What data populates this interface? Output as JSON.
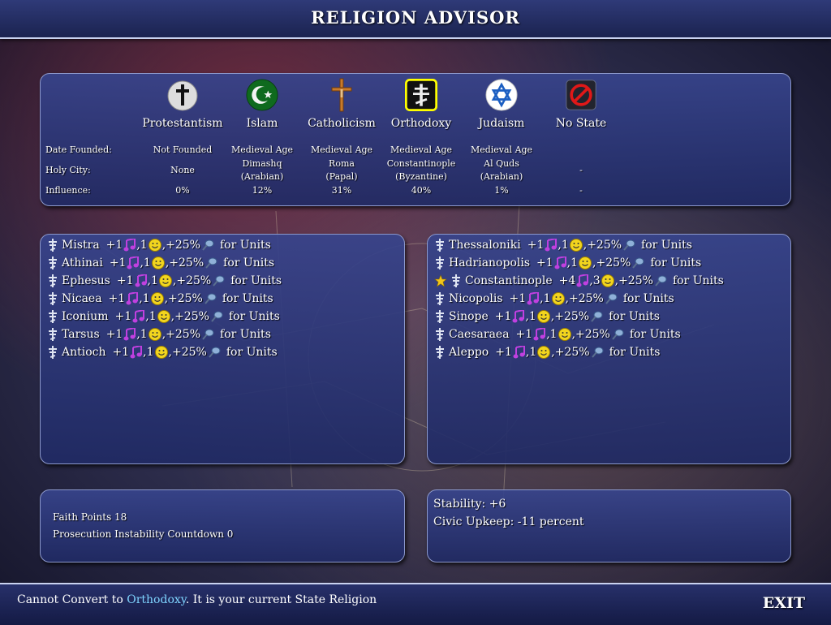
{
  "window": {
    "title": "RELIGION ADVISOR"
  },
  "religions": [
    {
      "name": "Protestantism",
      "icon": "protestantism-icon",
      "date_founded": "Not Founded",
      "holy_city": [
        "None"
      ],
      "influence": "0%",
      "selected": false
    },
    {
      "name": "Islam",
      "icon": "islam-icon",
      "date_founded": "Medieval Age",
      "holy_city": [
        "Dimashq",
        "(Arabian)"
      ],
      "influence": "12%",
      "selected": false
    },
    {
      "name": "Catholicism",
      "icon": "catholicism-icon",
      "date_founded": "Medieval Age",
      "holy_city": [
        "Roma",
        "(Papal)"
      ],
      "influence": "31%",
      "selected": false
    },
    {
      "name": "Orthodoxy",
      "icon": "orthodoxy-icon",
      "date_founded": "Medieval Age",
      "holy_city": [
        "Constantinople",
        "(Byzantine)"
      ],
      "influence": "40%",
      "selected": true
    },
    {
      "name": "Judaism",
      "icon": "judaism-icon",
      "date_founded": "Medieval Age",
      "holy_city": [
        "Al Quds",
        "(Arabian)"
      ],
      "influence": "1%",
      "selected": false
    },
    {
      "name": "No State",
      "icon": "no-state-icon",
      "date_founded": "",
      "holy_city": [
        "-"
      ],
      "influence": "-",
      "selected": false
    }
  ],
  "row_labels": {
    "date_founded": "Date Founded:",
    "holy_city": "Holy City:",
    "influence": "Influence:"
  },
  "city_lists": {
    "left": [
      {
        "name": "Mistra",
        "culture": "+1",
        "happy": "1",
        "bonus": "+25%",
        "suffix": "for Units",
        "capital": false
      },
      {
        "name": "Athinai",
        "culture": "+1",
        "happy": "1",
        "bonus": "+25%",
        "suffix": "for Units",
        "capital": false
      },
      {
        "name": "Ephesus",
        "culture": "+1",
        "happy": "1",
        "bonus": "+25%",
        "suffix": "for Units",
        "capital": false
      },
      {
        "name": "Nicaea",
        "culture": "+1",
        "happy": "1",
        "bonus": "+25%",
        "suffix": "for Units",
        "capital": false
      },
      {
        "name": "Iconium",
        "culture": "+1",
        "happy": "1",
        "bonus": "+25%",
        "suffix": "for Units",
        "capital": false
      },
      {
        "name": "Tarsus",
        "culture": "+1",
        "happy": "1",
        "bonus": "+25%",
        "suffix": "for Units",
        "capital": false
      },
      {
        "name": "Antioch",
        "culture": "+1",
        "happy": "1",
        "bonus": "+25%",
        "suffix": "for Units",
        "capital": false
      }
    ],
    "right": [
      {
        "name": "Thessaloniki",
        "culture": "+1",
        "happy": "1",
        "bonus": "+25%",
        "suffix": "for Units",
        "capital": false
      },
      {
        "name": "Hadrianopolis",
        "culture": "+1",
        "happy": "1",
        "bonus": "+25%",
        "suffix": "for Units",
        "capital": false
      },
      {
        "name": "Constantinople",
        "culture": "+4",
        "happy": "3",
        "bonus": "+25%",
        "suffix": "for Units",
        "capital": true
      },
      {
        "name": "Nicopolis",
        "culture": "+1",
        "happy": "1",
        "bonus": "+25%",
        "suffix": "for Units",
        "capital": false
      },
      {
        "name": "Sinope",
        "culture": "+1",
        "happy": "1",
        "bonus": "+25%",
        "suffix": "for Units",
        "capital": false
      },
      {
        "name": "Caesaraea",
        "culture": "+1",
        "happy": "1",
        "bonus": "+25%",
        "suffix": "for Units",
        "capital": false
      },
      {
        "name": "Aleppo",
        "culture": "+1",
        "happy": "1",
        "bonus": "+25%",
        "suffix": "for Units",
        "capital": false
      }
    ]
  },
  "faith": {
    "points": "Faith Points 18",
    "countdown": "Prosecution Instability Countdown 0"
  },
  "stability": {
    "stability": "Stability: +6",
    "upkeep": "Civic Upkeep: -11 percent"
  },
  "status": {
    "prefix": "Cannot Convert to ",
    "religion": "Orthodoxy",
    "suffix": ". It is your current State Religion"
  },
  "exit_label": "EXIT",
  "colors": {
    "highlight": "#7fd4ff",
    "culture": "#c040e0",
    "happy": "#f2d51e",
    "selected_border": "#ffff00"
  }
}
